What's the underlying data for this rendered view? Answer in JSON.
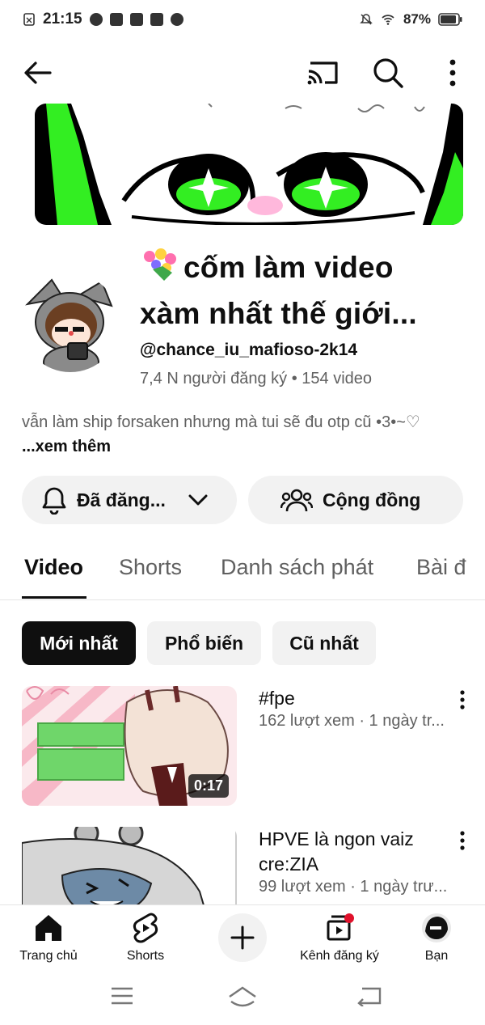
{
  "status_bar": {
    "time": "21:15",
    "battery": "87%"
  },
  "app_bar": {
    "back_icon": "arrow-left-icon",
    "cast_icon": "cast-icon",
    "search_icon": "search-icon",
    "more_icon": "more-vertical-icon"
  },
  "channel": {
    "title_line1": "cốm làm video",
    "title_line2": "xàm nhất thế giới...",
    "handle": "@chance_iu_mafioso-2k14",
    "stats": "7,4 N người đăng ký • 154 video",
    "description": "vẫn làm ship forsaken nhưng mà tui sẽ đu otp cũ •3•~♡ ",
    "description_more": "...xem thêm"
  },
  "actions": {
    "subscribed_label": "Đã đăng...",
    "community_label": "Cộng đồng"
  },
  "tabs": [
    {
      "label": "Video",
      "active": true
    },
    {
      "label": "Shorts",
      "active": false
    },
    {
      "label": "Danh sách phát",
      "active": false
    },
    {
      "label": "Bài đ",
      "active": false
    }
  ],
  "chips": [
    {
      "label": "Mới nhất",
      "active": true
    },
    {
      "label": "Phổ biến",
      "active": false
    },
    {
      "label": "Cũ nhất",
      "active": false
    }
  ],
  "videos": [
    {
      "title": "#fpe",
      "meta": "162 lượt xem · 1 ngày tr...",
      "duration": "0:17"
    },
    {
      "title": "HPVE là ngon vaiz cre:ZIA",
      "meta": "99 lượt xem · 1 ngày trư...",
      "duration": ""
    }
  ],
  "bottom_nav": {
    "home": "Trang chủ",
    "shorts": "Shorts",
    "subscriptions": "Kênh đăng ký",
    "you": "Bạn"
  },
  "colors": {
    "accent_green": "#33ee22",
    "notification_dot": "#e0112b",
    "chip_active_bg": "#0f0f0f",
    "pill_bg": "#f2f2f2",
    "secondary_text": "#606060"
  }
}
